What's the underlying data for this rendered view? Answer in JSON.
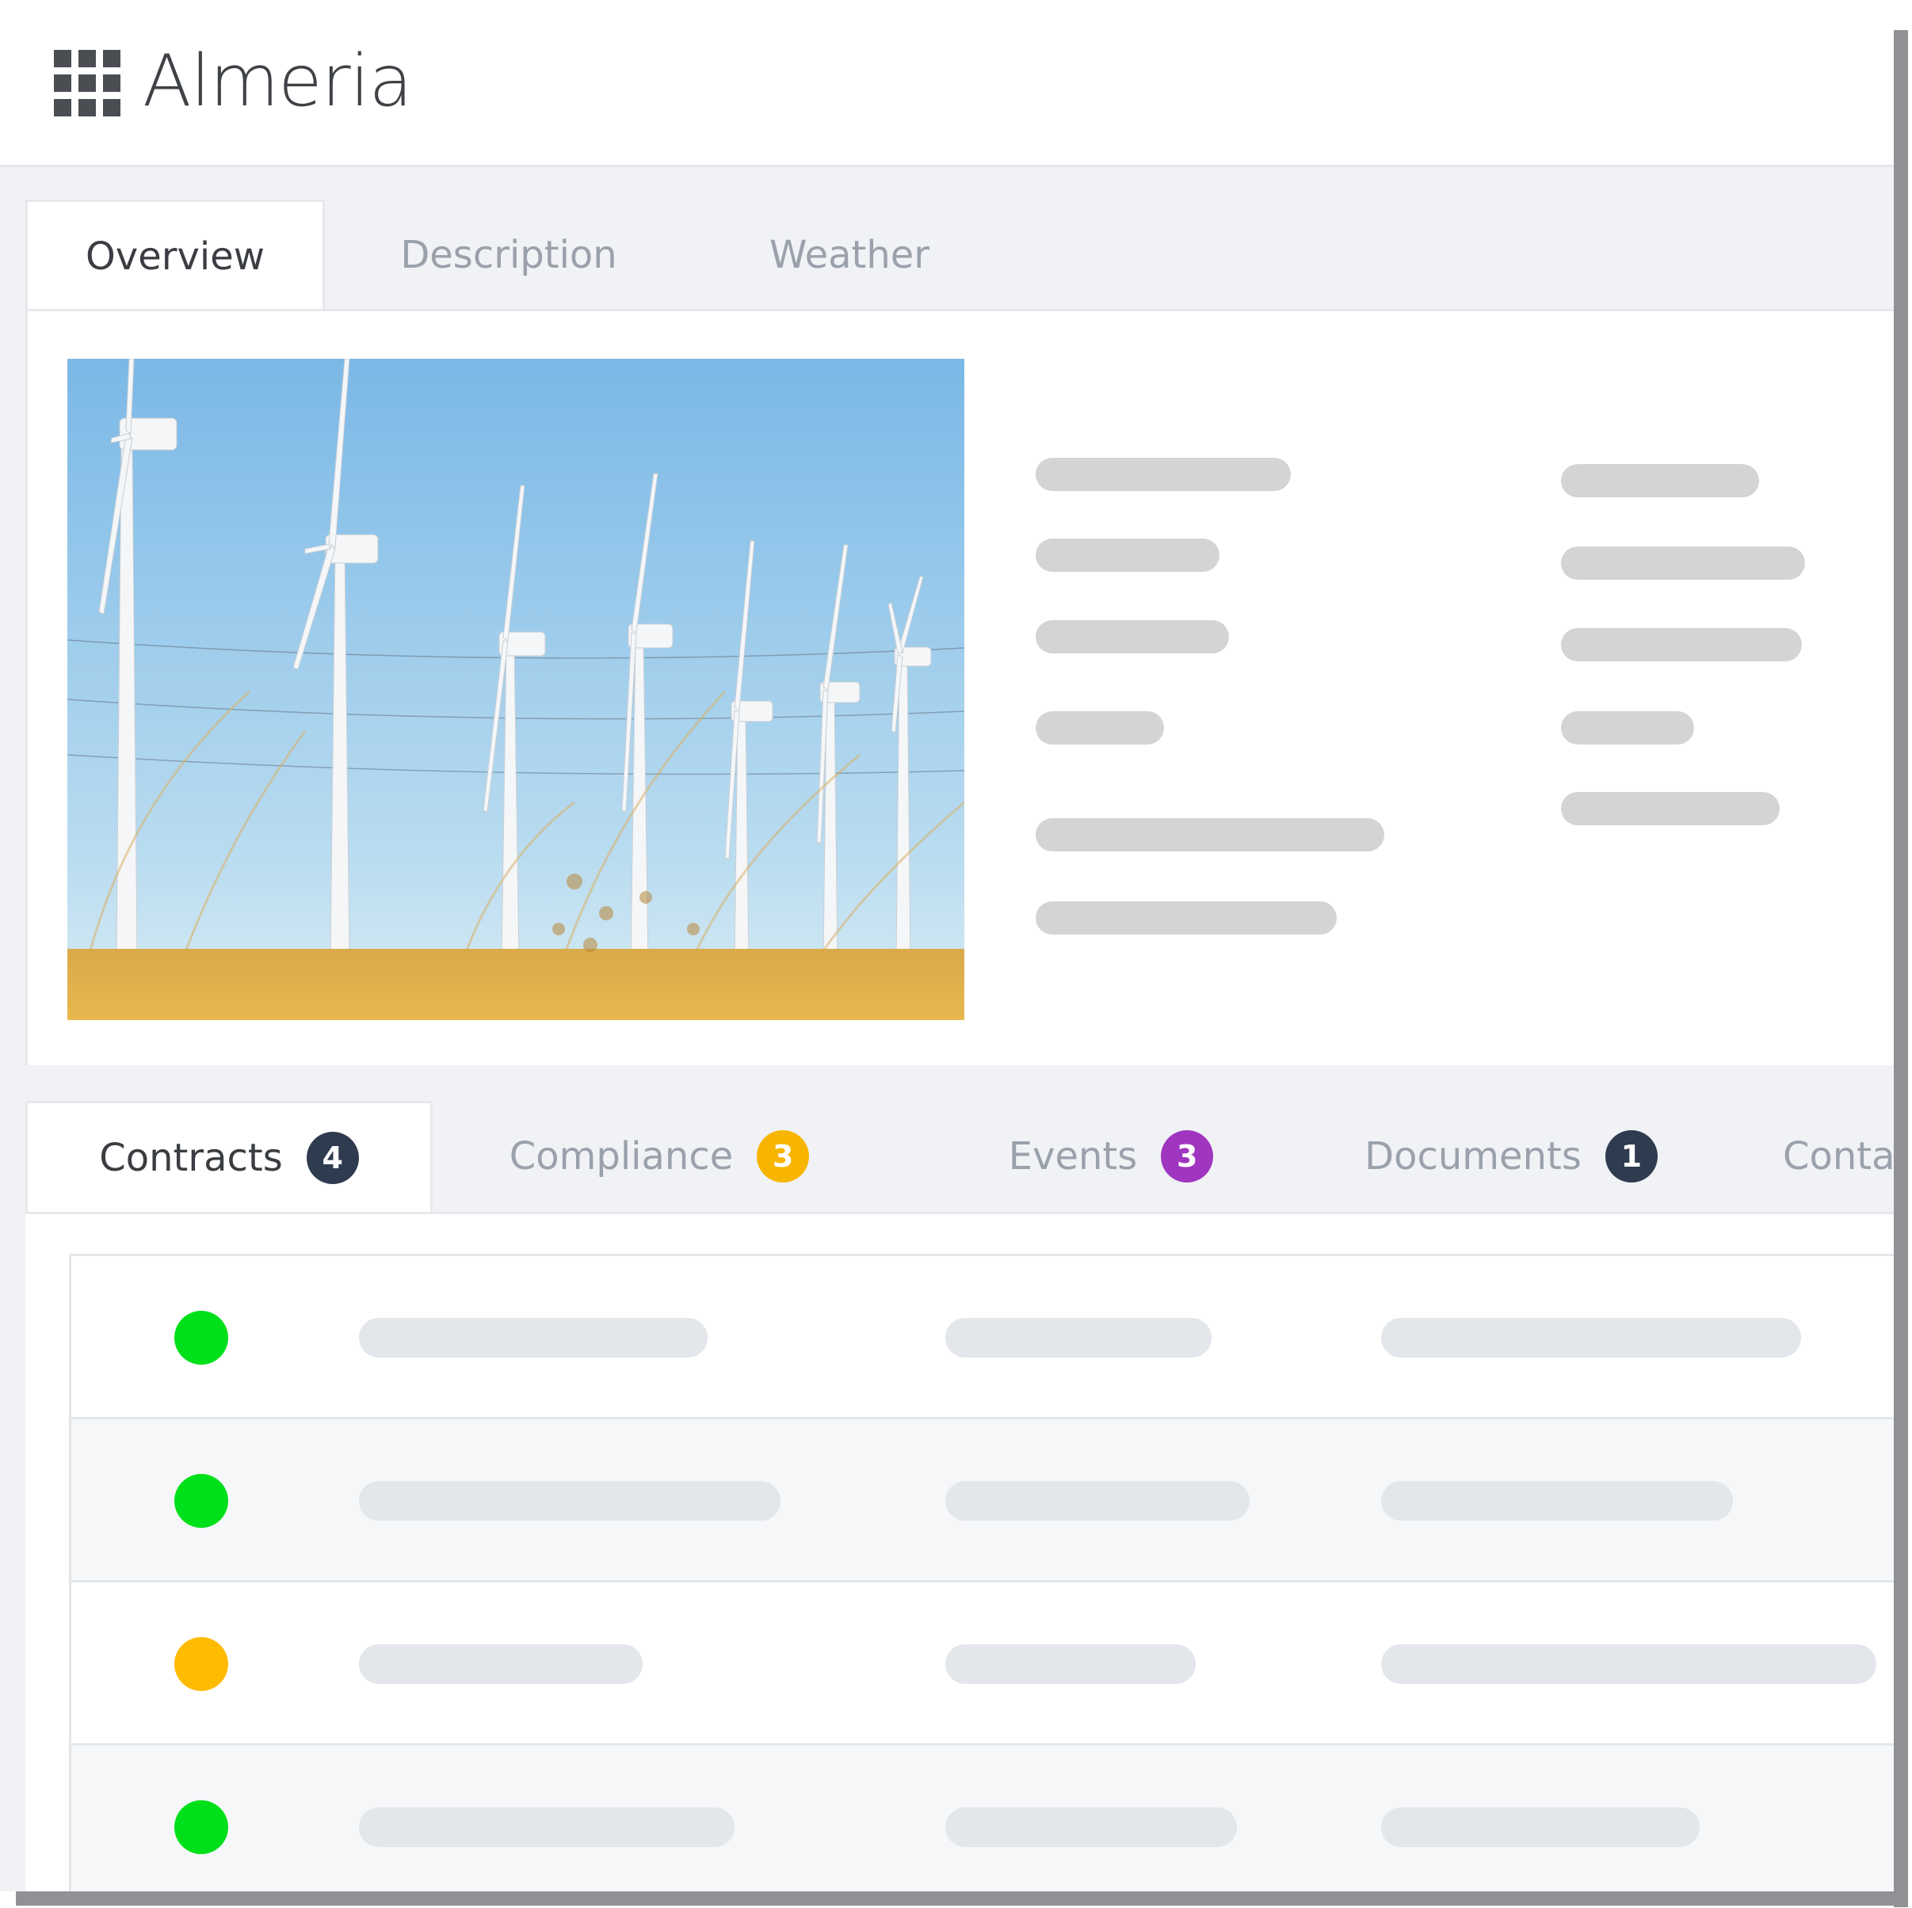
{
  "app": {
    "title": "Almeria",
    "menu_icon": "app-grid-icon"
  },
  "top_tabs": [
    {
      "label": "Overview",
      "active": true
    },
    {
      "label": "Description",
      "active": false
    },
    {
      "label": "Weather",
      "active": false
    }
  ],
  "overview": {
    "image": "wind-farm-photo"
  },
  "bottom_tabs": [
    {
      "label": "Contracts",
      "badge": "4",
      "badge_color": "#2f3b4f",
      "active": true
    },
    {
      "label": "Compliance",
      "badge": "3",
      "badge_color": "#f7b500",
      "active": false
    },
    {
      "label": "Events",
      "badge": "3",
      "badge_color": "#a035c0",
      "active": false
    },
    {
      "label": "Documents",
      "badge": "1",
      "badge_color": "#2f3b4f",
      "active": false
    },
    {
      "label": "Conta",
      "active": false
    }
  ],
  "contracts": {
    "rows": [
      {
        "status": "green",
        "status_color": "#00e01a"
      },
      {
        "status": "green",
        "status_color": "#00e01a"
      },
      {
        "status": "orange",
        "status_color": "#ffbb00"
      },
      {
        "status": "green",
        "status_color": "#00e01a"
      }
    ]
  },
  "colors": {
    "accent_dark": "#2f3b4f",
    "skeleton": "#d3d4d6",
    "status_green": "#00e01a",
    "status_orange": "#ffbb00"
  }
}
